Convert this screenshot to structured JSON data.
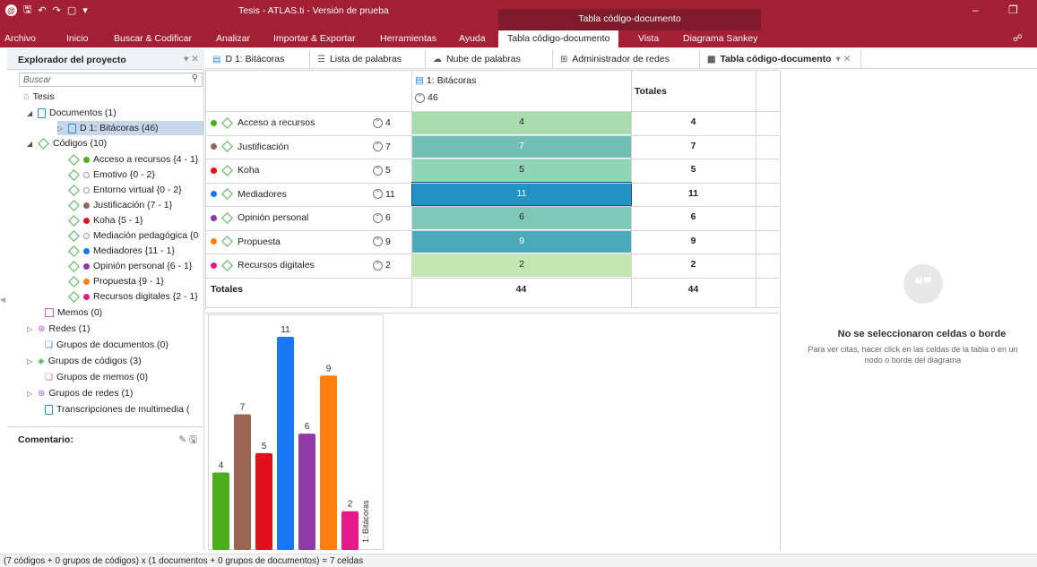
{
  "window": {
    "title": "Tesis - ATLAS.ti - Versión de prueba",
    "context_title": "Tabla código-documento"
  },
  "ribbon_tabs": [
    "Archivo",
    "Inicio",
    "Buscar & Codificar",
    "Analizar",
    "Importar & Exportar",
    "Herramientas",
    "Ayuda",
    "Tabla código-documento",
    "Vista",
    "Diagrama Sankey"
  ],
  "explorer": {
    "title": "Explorador del proyecto",
    "search_placeholder": "Buscar",
    "root": "Tesis",
    "documents": "Documentos (1)",
    "doc_item": "D 1: Bitácoras (46)",
    "codes": "Códigos (10)",
    "code_items": [
      {
        "label": "Acceso a recursos {4 - 1}",
        "color": "#4cae1c",
        "filled": true
      },
      {
        "label": "Emotivo {0 - 2}",
        "color": "#999999",
        "filled": false
      },
      {
        "label": "Entorno virtual {0 - 2}",
        "color": "#999999",
        "filled": false
      },
      {
        "label": "Justificación {7 - 1}",
        "color": "#8f6a5a",
        "filled": true
      },
      {
        "label": "Koha {5 - 1}",
        "color": "#e0111a",
        "filled": true
      },
      {
        "label": "Mediación pedagógica {0",
        "color": "#999999",
        "filled": false
      },
      {
        "label": "Mediadores {11 - 1}",
        "color": "#1877f2",
        "filled": true
      },
      {
        "label": "Opinión personal {6 - 1}",
        "color": "#8e3aa7",
        "filled": true
      },
      {
        "label": "Propuesta {9 - 1}",
        "color": "#ff7f0e",
        "filled": true
      },
      {
        "label": "Recursos digitales {2 - 1}",
        "color": "#e6198a",
        "filled": true
      }
    ],
    "memos": "Memos (0)",
    "networks": "Redes (1)",
    "doc_groups": "Grupos de documentos (0)",
    "code_groups": "Grupos de códigos (3)",
    "memo_groups": "Grupos de memos (0)",
    "network_groups": "Grupos de redes (1)",
    "transcriptions": "Transcripciones de multimedia (",
    "comment_label": "Comentario:"
  },
  "doc_tabs": [
    "D 1: Bitácoras",
    "Lista de palabras",
    "Nube de palabras",
    "Administrador de redes",
    "Tabla código-documento"
  ],
  "table": {
    "column_header": "1: Bitácoras",
    "column_count": "46",
    "totals_header": "Totales",
    "totals_row_label": "Totales",
    "totals_col_value": "44",
    "totals_total_value": "44",
    "rows": [
      {
        "name": "Acceso a recursos",
        "quotes": "4",
        "value": "4",
        "total": "4",
        "dot": "#4cae1c",
        "shade": "#a9ddb0"
      },
      {
        "name": "Justificación",
        "quotes": "7",
        "value": "7",
        "total": "7",
        "dot": "#8f6a5a",
        "shade": "#72bdb4"
      },
      {
        "name": "Koha",
        "quotes": "5",
        "value": "5",
        "total": "5",
        "dot": "#e0111a",
        "shade": "#90d3b6"
      },
      {
        "name": "Mediadores",
        "quotes": "11",
        "value": "11",
        "total": "11",
        "dot": "#1877f2",
        "shade": "#2291c3"
      },
      {
        "name": "Opinión personal",
        "quotes": "6",
        "value": "6",
        "total": "6",
        "dot": "#8e3aa7",
        "shade": "#80c8b6"
      },
      {
        "name": "Propuesta",
        "quotes": "9",
        "value": "9",
        "total": "9",
        "dot": "#ff7f0e",
        "shade": "#4aaab9"
      },
      {
        "name": "Recursos digitales",
        "quotes": "2",
        "value": "2",
        "total": "2",
        "dot": "#e6198a",
        "shade": "#c3e6b2"
      }
    ]
  },
  "chart_data": {
    "type": "bar",
    "categories": [
      "Acceso a recursos",
      "Justificación",
      "Koha",
      "Mediadores",
      "Opinión personal",
      "Propuesta",
      "Recursos digitales"
    ],
    "values": [
      4,
      7,
      5,
      11,
      6,
      9,
      2
    ],
    "colors": [
      "#4cae1c",
      "#9a6553",
      "#e0111a",
      "#1877f2",
      "#8e3aa7",
      "#ff7f0e",
      "#e6198a"
    ],
    "group_label": "1: Bitácoras",
    "ylim": [
      0,
      11
    ]
  },
  "info_pane": {
    "title": "No se seleccionaron celdas o borde",
    "desc_line1": "Para ver citas, hacer click en las celdas de la tabla o en un",
    "desc_line2": "nodo o borde del diagrama"
  },
  "status": "(7 códigos + 0 grupos de códigos) x (1 documentos + 0 grupos de documentos) = 7 celdas"
}
